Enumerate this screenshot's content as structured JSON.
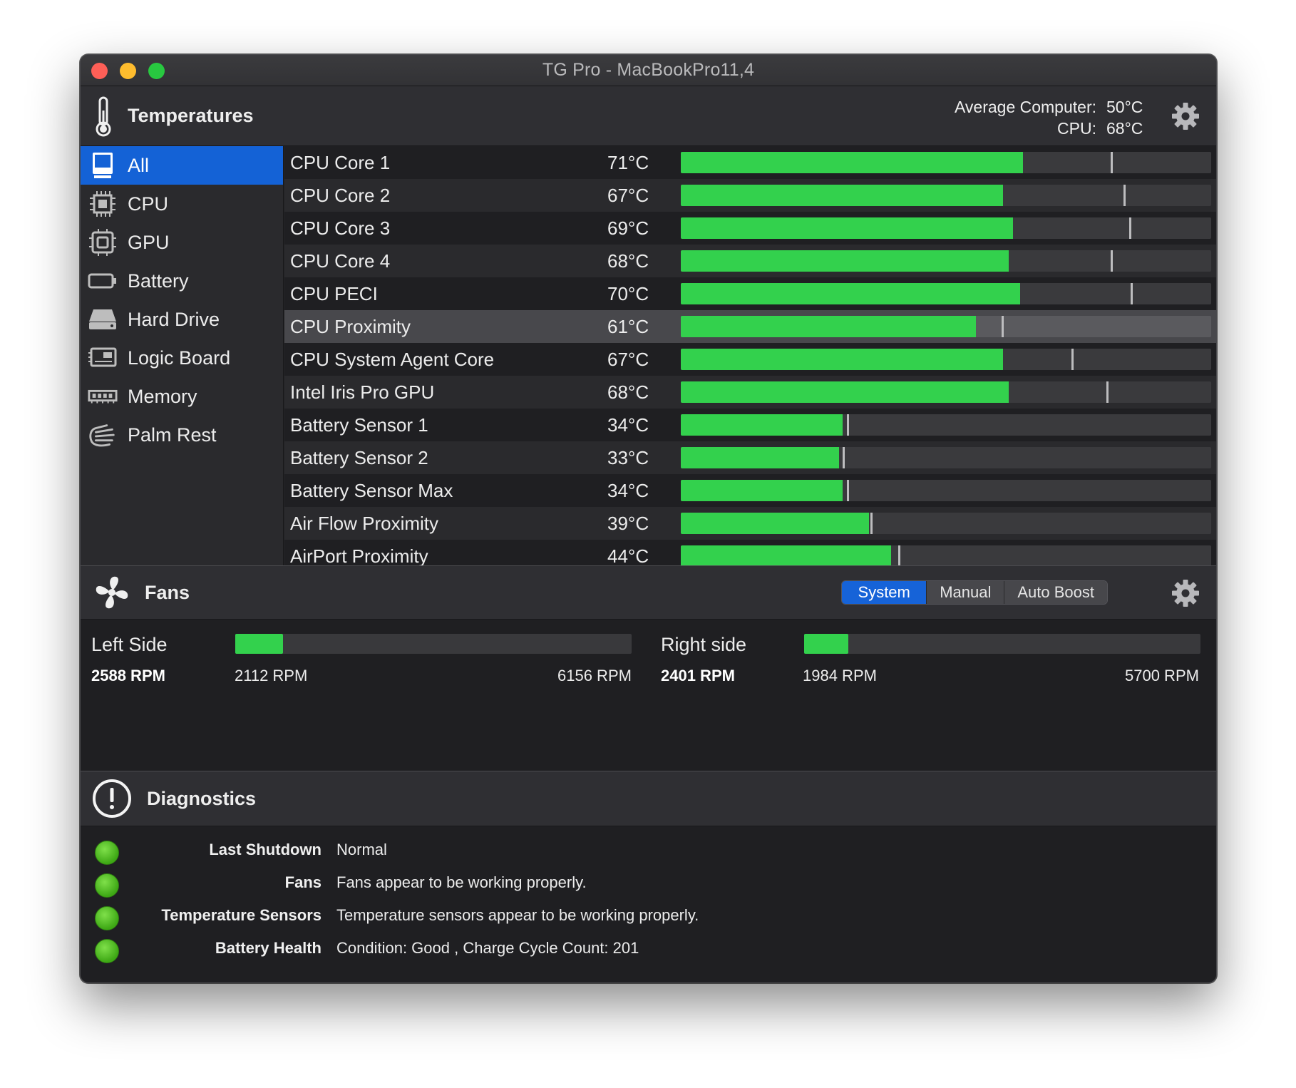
{
  "window": {
    "title": "TG Pro - MacBookPro11,4"
  },
  "temperatures": {
    "header": "Temperatures",
    "average_label": "Average Computer:",
    "average_value": "50°C",
    "cpu_label": "CPU:",
    "cpu_value": "68°C",
    "sidebar": [
      {
        "label": "All",
        "icon": "computer-icon"
      },
      {
        "label": "CPU",
        "icon": "cpu-chip-icon"
      },
      {
        "label": "GPU",
        "icon": "gpu-chip-icon"
      },
      {
        "label": "Battery",
        "icon": "battery-icon"
      },
      {
        "label": "Hard Drive",
        "icon": "hard-drive-icon"
      },
      {
        "label": "Logic Board",
        "icon": "logic-board-icon"
      },
      {
        "label": "Memory",
        "icon": "memory-icon"
      },
      {
        "label": "Palm Rest",
        "icon": "palm-rest-icon"
      }
    ],
    "sensors": [
      {
        "name": "CPU Core 1",
        "value": "71°C",
        "level": 0.645,
        "max_level": 0.81
      },
      {
        "name": "CPU Core 2",
        "value": "67°C",
        "level": 0.608,
        "max_level": 0.835
      },
      {
        "name": "CPU Core 3",
        "value": "69°C",
        "level": 0.627,
        "max_level": 0.845
      },
      {
        "name": "CPU Core 4",
        "value": "68°C",
        "level": 0.618,
        "max_level": 0.81
      },
      {
        "name": "CPU PECI",
        "value": "70°C",
        "level": 0.64,
        "max_level": 0.848
      },
      {
        "name": "CPU Proximity",
        "value": "61°C",
        "level": 0.556,
        "max_level": 0.605
      },
      {
        "name": "CPU System Agent Core",
        "value": "67°C",
        "level": 0.608,
        "max_level": 0.737
      },
      {
        "name": "Intel Iris Pro GPU",
        "value": "68°C",
        "level": 0.618,
        "max_level": 0.803
      },
      {
        "name": "Battery Sensor 1",
        "value": "34°C",
        "level": 0.305,
        "max_level": 0.313
      },
      {
        "name": "Battery Sensor 2",
        "value": "33°C",
        "level": 0.298,
        "max_level": 0.305
      },
      {
        "name": "Battery Sensor Max",
        "value": "34°C",
        "level": 0.305,
        "max_level": 0.313
      },
      {
        "name": "Air Flow Proximity",
        "value": "39°C",
        "level": 0.355,
        "max_level": 0.358
      },
      {
        "name": "AirPort Proximity",
        "value": "44°C",
        "level": 0.396,
        "max_level": 0.41
      }
    ]
  },
  "fans": {
    "header": "Fans",
    "modes": [
      "System",
      "Manual",
      "Auto Boost"
    ],
    "selected_mode": "System",
    "left": {
      "label": "Left Side",
      "rpm": "2588 RPM",
      "min": "2112 RPM",
      "max": "6156 RPM",
      "level": 0.12
    },
    "right": {
      "label": "Right side",
      "rpm": "2401 RPM",
      "min": "1984 RPM",
      "max": "5700 RPM",
      "level": 0.112
    }
  },
  "diagnostics": {
    "header": "Diagnostics",
    "rows": [
      {
        "key": "Last Shutdown",
        "value": "Normal",
        "status_color": "#4cb81c"
      },
      {
        "key": "Fans",
        "value": "Fans appear to be working properly.",
        "status_color": "#4cb81c"
      },
      {
        "key": "Temperature Sensors",
        "value": "Temperature sensors appear to be working properly.",
        "status_color": "#4cb81c"
      },
      {
        "key": "Battery Health",
        "value": "Condition: Good , Charge Cycle Count: 201",
        "status_color": "#4cb81c"
      }
    ]
  },
  "colors": {
    "accent": "#1462d6",
    "bar_fill": "#33d14d",
    "background": "#232326"
  }
}
